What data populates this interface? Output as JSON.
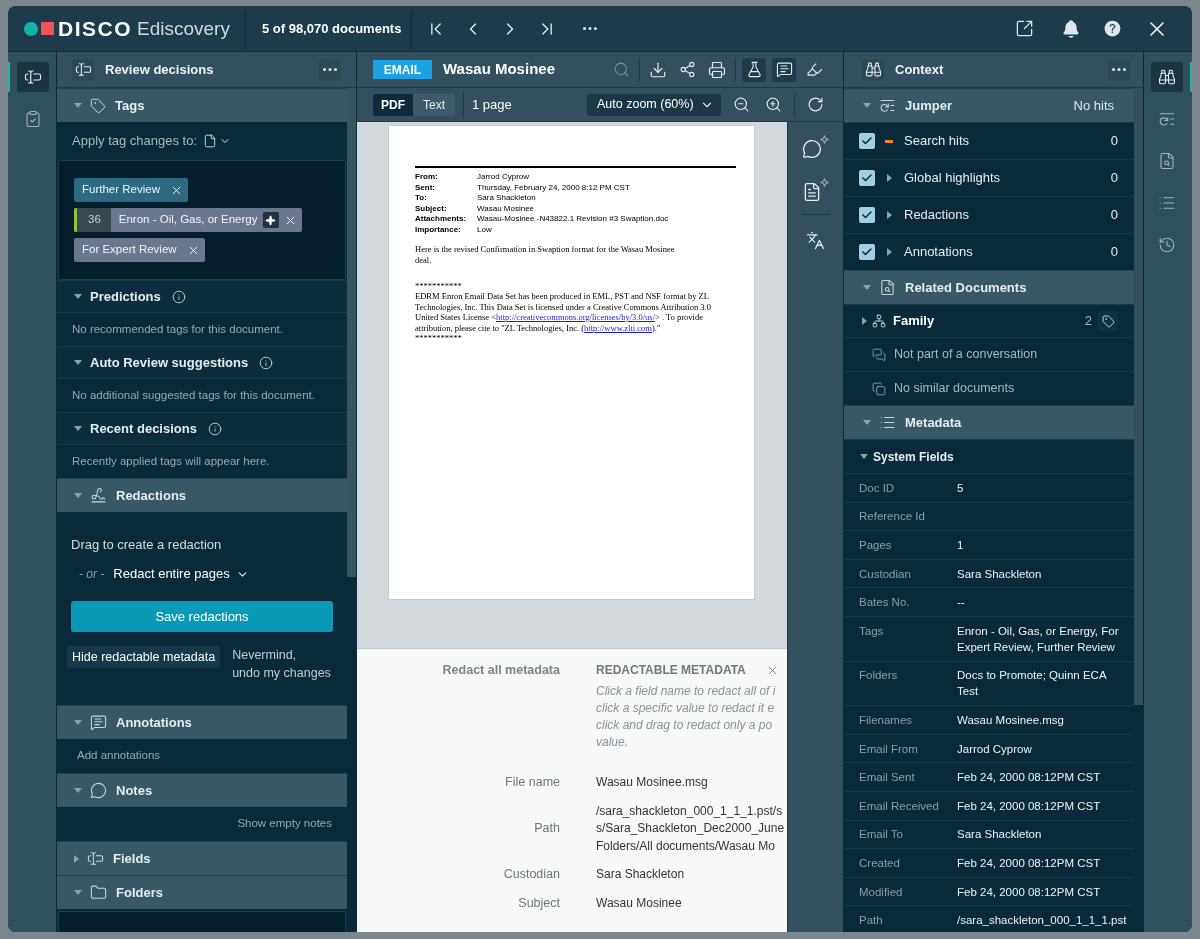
{
  "header": {
    "brand": "DISCO",
    "product": "Ediscovery",
    "position": "5 of 98,070 documents"
  },
  "left_rail": [
    {
      "selected": true
    },
    {
      "selected": false
    }
  ],
  "review_panel": {
    "title": "Review decisions",
    "sections": [
      {
        "kind": "tags",
        "title": "Tags",
        "expanded": true,
        "apply_label": "Apply tag changes to:",
        "tags": [
          {
            "label": "Further Review",
            "color": "#2b6a82",
            "ai_suggested": false
          },
          {
            "label": "Enron - Oil, Gas, or Energy",
            "color": "#6a778f",
            "count": "36",
            "ai_suggested": true
          },
          {
            "label": "For Expert Review",
            "color": "#6a778f",
            "ai_suggested": false
          }
        ],
        "subsections": [
          {
            "title": "Predictions",
            "expanded": true,
            "message": "No recommended tags for this document."
          },
          {
            "title": "Auto Review suggestions",
            "expanded": true,
            "message": "No additional suggested tags for this document."
          },
          {
            "title": "Recent decisions",
            "expanded": true,
            "message": "Recently applied tags will appear here."
          }
        ]
      },
      {
        "kind": "redactions",
        "title": "Redactions",
        "expanded": true,
        "instruction": "Drag to create a redaction",
        "or_label": "- or -",
        "pages_option": "Redact entire pages",
        "save_button": "Save redactions",
        "hide_button": "Hide redactable metadata",
        "undo_link_lines": [
          "Nevermind,",
          "undo my changes"
        ]
      },
      {
        "kind": "annotations",
        "title": "Annotations",
        "expanded": true,
        "message": "Add annotations"
      },
      {
        "kind": "notes",
        "title": "Notes",
        "expanded": true,
        "action": "Show empty notes"
      },
      {
        "kind": "fields",
        "title": "Fields",
        "expanded": false
      },
      {
        "kind": "folders",
        "title": "Folders",
        "expanded": true
      }
    ]
  },
  "document": {
    "type": "EMAIL",
    "title": "Wasau Mosinee",
    "view_toggles": [
      {
        "active": true
      },
      {
        "active": true
      },
      {
        "active": false
      }
    ],
    "modes": [
      {
        "label": "PDF",
        "selected": true
      },
      {
        "label": "Text",
        "selected": false
      }
    ],
    "page_count": "1 page",
    "zoom": "Auto zoom (60%)"
  },
  "page": {
    "header_fields": [
      {
        "label": "From:",
        "value": "Jarrod Cyprow"
      },
      {
        "label": "Sent:",
        "value": "Thursday, February 24, 2000 8:12 PM CST"
      },
      {
        "label": "To:",
        "value": "Sara Shackleton"
      },
      {
        "label": "Subject:",
        "value": "Wasau Mosinee"
      },
      {
        "label": "Attachments:",
        "value": "Wasau-Mosinee -N43822.1 Revision #3 Swaption.doc"
      },
      {
        "label": "Importance:",
        "value": "Low"
      }
    ],
    "body_lines": [
      "Here is the revised Confirmation in Swaption format for the Wasau Mosinee",
      "deal."
    ],
    "separator": "***********",
    "footer_lines": [
      [
        {
          "kind": "text",
          "text": "EDRM Enron Email Data Set has been produced in EML, PST and NSF format by ZL Technologies, Inc. This Data"
        }
      ],
      [
        {
          "kind": "text",
          "text": "Set is licensed under a Creative Commons Attribution 3.0 United States License"
        }
      ],
      [
        {
          "kind": "text",
          "text": "<"
        },
        {
          "kind": "link",
          "text": "http://creativecommons.org/licenses/by/3.0/us/"
        },
        {
          "kind": "text",
          "text": "> . To provide attribution, please cite to \"ZL Technologies, Inc."
        }
      ],
      [
        {
          "kind": "text",
          "text": "("
        },
        {
          "kind": "link",
          "text": "http://www.zlti.com"
        },
        {
          "kind": "text",
          "text": ").\""
        }
      ]
    ],
    "closing_separator": "***********"
  },
  "redactable_metadata": {
    "redact_all": "Redact all metadata",
    "title": "REDACTABLE METADATA",
    "hint_lines": [
      "Click a field name to redact all of i",
      "click a specific value to redact it e",
      "click and drag to redact only a po",
      "value."
    ],
    "fields": [
      {
        "label": "File name",
        "value_lines": [
          "Wasau Mosinee.msg"
        ]
      },
      {
        "label": "Path",
        "value_lines": [
          "/sara_shackleton_000_1_1_1.pst/s",
          "s/Sara_Shackleton_Dec2000_June",
          "Folders/All documents/Wasau Mo"
        ]
      },
      {
        "label": "Custodian",
        "value_lines": [
          "Sara Shackleton"
        ]
      },
      {
        "label": "Subject",
        "value_lines": [
          "Wasau Mosinee"
        ]
      }
    ]
  },
  "context_panel": {
    "title": "Context",
    "jumper": {
      "title": "Jumper",
      "expanded": true,
      "status": "No hits",
      "items": [
        {
          "kind": "search",
          "label": "Search hits",
          "count": "0",
          "checked": true
        },
        {
          "kind": "group",
          "label": "Global highlights",
          "count": "0",
          "checked": true,
          "expanded": false
        },
        {
          "kind": "group",
          "label": "Redactions",
          "count": "0",
          "checked": true,
          "expanded": false
        },
        {
          "kind": "group",
          "label": "Annotations",
          "count": "0",
          "checked": true,
          "expanded": false
        }
      ]
    },
    "related": {
      "title": "Related Documents",
      "expanded": true,
      "family": {
        "label": "Family",
        "count": "2",
        "expanded": false
      },
      "items": [
        {
          "kind": "conversation",
          "text": "Not part of a conversation"
        },
        {
          "kind": "similar",
          "text": "No similar documents"
        }
      ]
    },
    "metadata": {
      "title": "Metadata",
      "expanded": true,
      "group": {
        "title": "System Fields",
        "expanded": true,
        "rows": [
          {
            "label": "Doc ID",
            "value": "5"
          },
          {
            "label": "Reference Id"
          },
          {
            "label": "Pages",
            "value": "1"
          },
          {
            "label": "Custodian",
            "value": "Sara Shackleton"
          },
          {
            "label": "Bates No.",
            "value": "--"
          },
          {
            "label": "Tags",
            "value": "Enron - Oil, Gas, or Energy, For Expert Review, Further Review"
          },
          {
            "label": "Folders",
            "value": "Docs to Promote; Quinn ECA Test"
          },
          {
            "label": "Filenames",
            "value": "Wasau Mosinee.msg"
          },
          {
            "label": "Email From",
            "value": "Jarrod Cyprow"
          },
          {
            "label": "Email Sent",
            "value": "Feb 24, 2000 08:12PM CST"
          },
          {
            "label": "Email Received",
            "value": "Feb 24, 2000 08:12PM CST"
          },
          {
            "label": "Email To",
            "value": "Sara Shackleton"
          },
          {
            "label": "Created",
            "value": "Feb 24, 2000 08:12PM CST"
          },
          {
            "label": "Modified",
            "value": "Feb 24, 2000 08:12PM CST"
          },
          {
            "label": "Path",
            "value": "/sara_shackleton_000_1_1_1.pst"
          }
        ]
      }
    }
  },
  "right_rail": [
    {
      "selected": true
    },
    {
      "selected": false
    },
    {
      "selected": false
    },
    {
      "selected": false
    },
    {
      "selected": false
    }
  ]
}
